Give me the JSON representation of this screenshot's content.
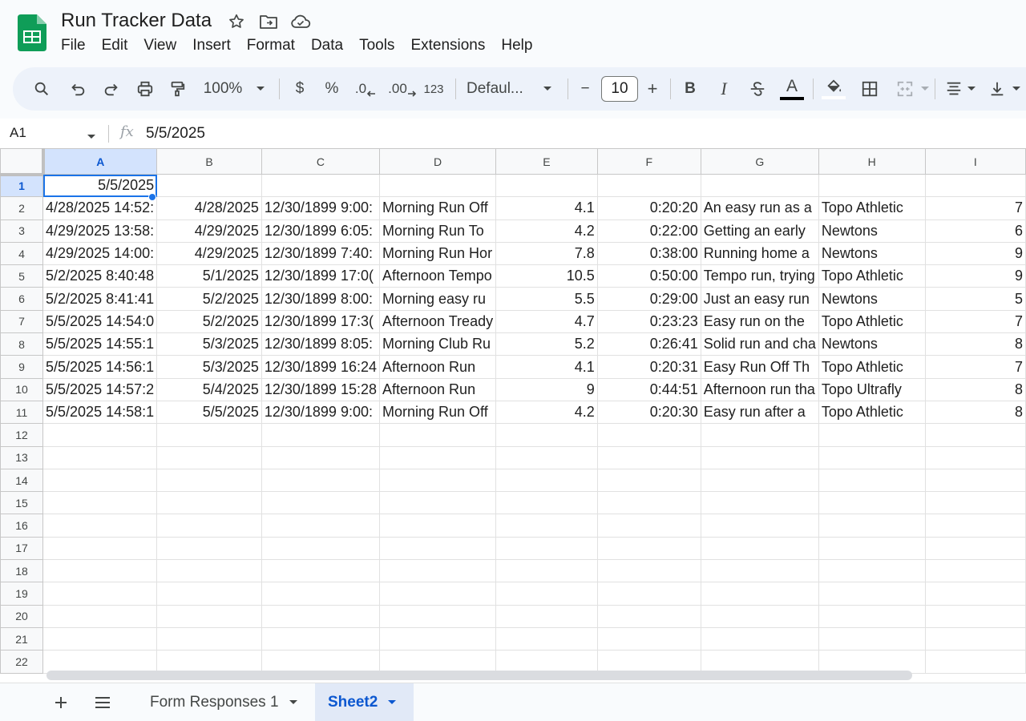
{
  "app": {
    "doc_title": "Run Tracker Data",
    "menu": [
      "File",
      "Edit",
      "View",
      "Insert",
      "Format",
      "Data",
      "Tools",
      "Extensions",
      "Help"
    ]
  },
  "toolbar": {
    "zoom": "100%",
    "currency": "$",
    "percent": "%",
    "dec_decrease": ".0",
    "dec_increase": ".00",
    "format_more": "123",
    "font": "Defaul...",
    "font_size": "10",
    "minus": "−",
    "plus": "+",
    "bold": "B",
    "italic": "I",
    "text_color": "A"
  },
  "formula_bar": {
    "cell_ref": "A1",
    "fx": "fx",
    "value": "5/5/2025"
  },
  "grid": {
    "columns": [
      "A",
      "B",
      "C",
      "D",
      "E",
      "F",
      "G",
      "H",
      "I"
    ],
    "selected_column": "A",
    "selected_row": "1",
    "row_numbers": [
      "1",
      "2",
      "3",
      "4",
      "5",
      "6",
      "7",
      "8",
      "9",
      "10",
      "11",
      "12",
      "13",
      "14",
      "15",
      "16",
      "17",
      "18",
      "19",
      "20",
      "21",
      "22"
    ],
    "rows": [
      [
        "5/5/2025",
        "",
        "",
        "",
        "",
        "",
        "",
        "",
        ""
      ],
      [
        "4/28/2025 14:52:",
        "4/28/2025",
        "12/30/1899 9:00:",
        "Morning Run Off",
        "4.1",
        "0:20:20",
        "An easy run as a",
        "Topo Athletic",
        "7"
      ],
      [
        "4/29/2025 13:58:",
        "4/29/2025",
        "12/30/1899 6:05:",
        "Morning Run To",
        "4.2",
        "0:22:00",
        "Getting an early",
        "Newtons",
        "6"
      ],
      [
        "4/29/2025 14:00:",
        "4/29/2025",
        "12/30/1899 7:40:",
        "Morning Run Hor",
        "7.8",
        "0:38:00",
        "Running home a",
        "Newtons",
        "9"
      ],
      [
        "5/2/2025 8:40:48",
        "5/1/2025",
        "12/30/1899 17:0(",
        "Afternoon Tempo",
        "10.5",
        "0:50:00",
        "Tempo run, trying",
        "Topo Athletic",
        "9"
      ],
      [
        "5/2/2025 8:41:41",
        "5/2/2025",
        "12/30/1899 8:00:",
        "Morning easy ru",
        "5.5",
        "0:29:00",
        "Just an easy run",
        "Newtons",
        "5"
      ],
      [
        "5/5/2025 14:54:0",
        "5/2/2025",
        "12/30/1899 17:3(",
        "Afternoon Tready",
        "4.7",
        "0:23:23",
        "Easy run on the",
        "Topo Athletic",
        "7"
      ],
      [
        "5/5/2025 14:55:1",
        "5/3/2025",
        "12/30/1899 8:05:",
        "Morning Club Ru",
        "5.2",
        "0:26:41",
        "Solid run and cha",
        "Newtons",
        "8"
      ],
      [
        "5/5/2025 14:56:1",
        "5/3/2025",
        "12/30/1899 16:24",
        "Afternoon Run",
        "4.1",
        "0:20:31",
        "Easy Run Off Th",
        "Topo Athletic",
        "7"
      ],
      [
        "5/5/2025 14:57:2",
        "5/4/2025",
        "12/30/1899 15:28",
        "Afternoon Run",
        "9",
        "0:44:51",
        "Afternoon run tha",
        "Topo Ultrafly",
        "8"
      ],
      [
        "5/5/2025 14:58:1",
        "5/5/2025",
        "12/30/1899 9:00:",
        "Morning Run Off",
        "4.2",
        "0:20:30",
        "Easy run after a",
        "Topo Athletic",
        "8"
      ]
    ]
  },
  "sheets": {
    "tabs": [
      "Form Responses 1",
      "Sheet2"
    ],
    "active": "Sheet2"
  },
  "colors": {
    "accent": "#0b57d0",
    "selection": "#1a73e8",
    "sheets_green": "#0f9d58"
  }
}
